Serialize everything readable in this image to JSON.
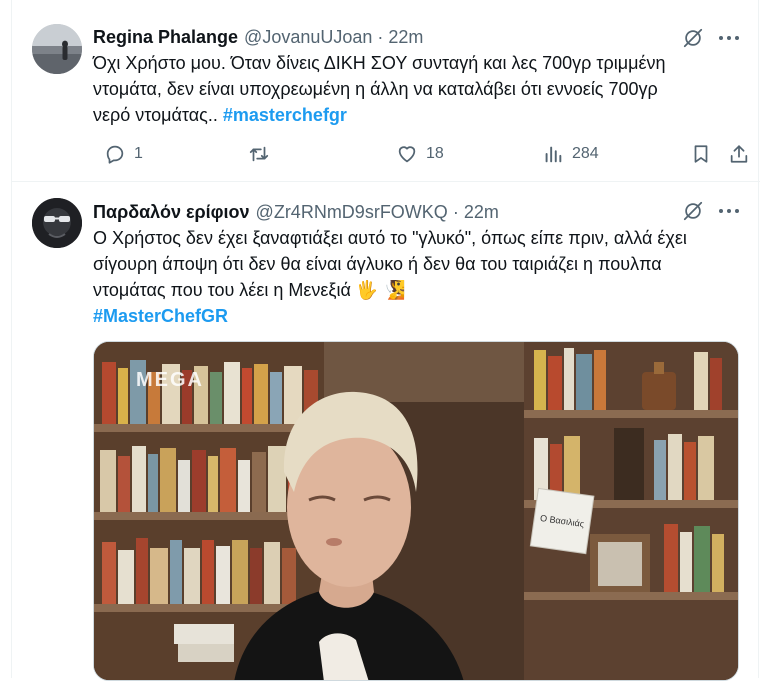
{
  "tweets": [
    {
      "display_name": "Regina Phalange",
      "handle": "@JovanuUJoan",
      "separator": "·",
      "time": "22m",
      "text_lines": [
        "Όχι Χρήστο μου. Όταν δίνεις ΔΙΚΗ ΣΟΥ συνταγή και λες 700γρ τριμμένη",
        "ντομάτα, δεν είναι υποχρεωμένη η άλλη να καταλάβει ότι εννοείς 700γρ",
        "νερό ντομάτας.."
      ],
      "hashtag": "#masterchefgr",
      "stats": {
        "replies": "1",
        "likes": "18",
        "views": "284"
      }
    },
    {
      "display_name": "Παρδαλόν ερίφιον",
      "handle": "@Zr4RNmD9srFOWKQ",
      "separator": "·",
      "time": "22m",
      "text_lines": [
        "Ο Χρήστος δεν έχει ξαναφτιάξει αυτό το \"γλυκό\", όπως είπε πριν, αλλά έχει",
        "σίγουρη άποψη ότι δεν θα είναι άγλυκο ή δεν θα του ταιριάζει η πουλπα",
        "ντομάτας που του λέει η Μενεξιά 🖐 🧏"
      ],
      "hashtag": "#MasterChefGR",
      "media": {
        "channel_logo": "MEGA",
        "book_label": "Ο Βασιλιάς"
      }
    }
  ],
  "icons": {
    "reply": "reply-icon",
    "retweet": "retweet-icon",
    "like": "heart-icon",
    "views": "views-icon",
    "bookmark": "bookmark-icon",
    "share": "share-icon",
    "grok": "grok-icon",
    "more": "more-icon"
  },
  "colors": {
    "accent": "#1d9bf0",
    "text": "#0f1419",
    "secondary": "#536471",
    "border": "#eff3f4"
  }
}
